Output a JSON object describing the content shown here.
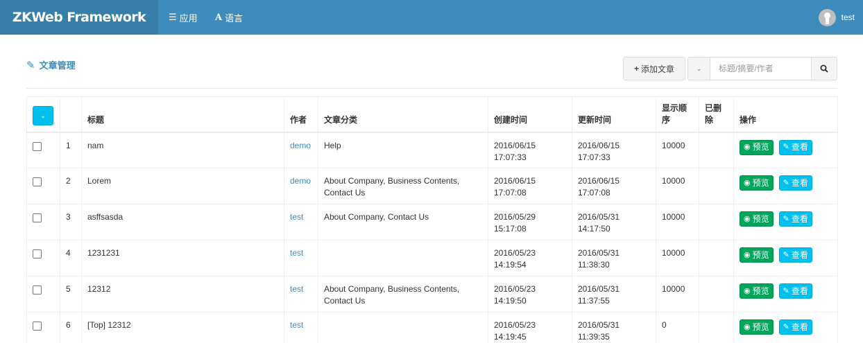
{
  "navbar": {
    "brand": "ZKWeb Framework",
    "apps_icon": "bars-icon",
    "apps_label": "应用",
    "lang_icon": "font-icon",
    "lang_label": "语言",
    "user_name": "test",
    "color": "#3c8dbc",
    "brand_color": "#367fa9"
  },
  "page": {
    "title": "文章管理",
    "title_icon": "pencil-icon"
  },
  "toolbar": {
    "add_label": "添加文章",
    "add_icon": "plus-icon",
    "search_placeholder": "标题/摘要/作者",
    "search_icon": "search-icon"
  },
  "table": {
    "columns": [
      "",
      "",
      "标题",
      "作者",
      "文章分类",
      "创建时间",
      "更新时间",
      "显示顺序",
      "已删除",
      "操作"
    ],
    "preview_label": "预览",
    "view_label": "查看",
    "rows": [
      {
        "id": "1",
        "title": "nam",
        "author": "demo",
        "category": "Help",
        "created": "2016/06/15 17:07:33",
        "updated": "2016/06/15 17:07:33",
        "order": "10000",
        "deleted": ""
      },
      {
        "id": "2",
        "title": "Lorem",
        "author": "demo",
        "category": "About Company, Business Contents, Contact Us",
        "created": "2016/06/15 17:07:08",
        "updated": "2016/06/15 17:07:08",
        "order": "10000",
        "deleted": ""
      },
      {
        "id": "3",
        "title": "asffsasda",
        "author": "test",
        "category": "About Company, Contact Us",
        "created": "2016/05/29 15:17:08",
        "updated": "2016/05/31 14:17:50",
        "order": "10000",
        "deleted": ""
      },
      {
        "id": "4",
        "title": "1231231",
        "author": "test",
        "category": "",
        "created": "2016/05/23 14:19:54",
        "updated": "2016/05/31 11:38:30",
        "order": "10000",
        "deleted": ""
      },
      {
        "id": "5",
        "title": "12312",
        "author": "test",
        "category": "About Company, Business Contents, Contact Us",
        "created": "2016/05/23 14:19:50",
        "updated": "2016/05/31 11:37:55",
        "order": "10000",
        "deleted": ""
      },
      {
        "id": "6",
        "title": "[Top] 12312",
        "author": "test",
        "category": "",
        "created": "2016/05/23 14:19:45",
        "updated": "2016/05/31 11:39:35",
        "order": "0",
        "deleted": ""
      }
    ]
  },
  "colors": {
    "success": "#00a65a",
    "info": "#00c0ef",
    "link": "#3c8dbc"
  }
}
